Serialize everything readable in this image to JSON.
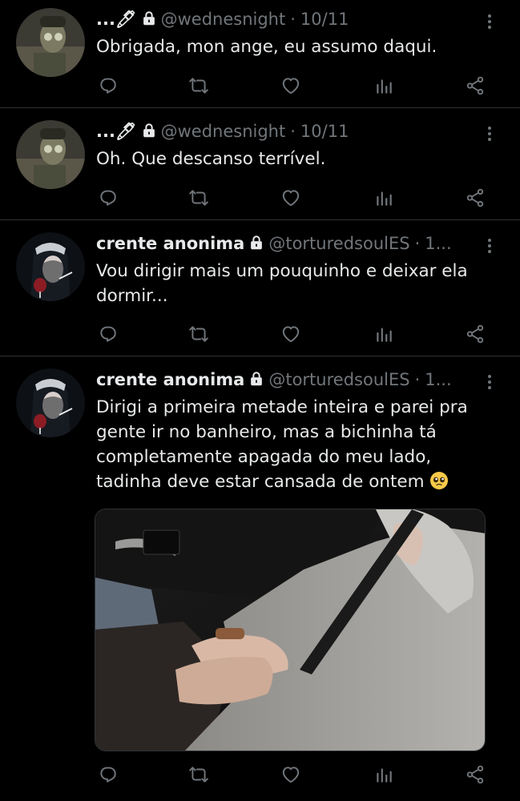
{
  "tweets": [
    {
      "name": "...🖊",
      "handle": "@wednesnight",
      "date": "10/11",
      "text": "Obrigada, mon ange, eu assumo daqui."
    },
    {
      "name": "...🖊",
      "handle": "@wednesnight",
      "date": "10/11",
      "text": "Oh. Que descanso terrível."
    },
    {
      "name": "crente anonima",
      "handle": "@torturedsoulES",
      "date": "1...",
      "text": "Vou dirigir mais um pouquinho e deixar ela dormir..."
    },
    {
      "name": "crente anonima",
      "handle": "@torturedsoulES",
      "date": "1...",
      "text": "Dirigi a primeira metade inteira e parei pra gente ir no banheiro, mas a bichinha tá completamente apagada do meu lado, tadinha deve estar cansada de ontem"
    }
  ],
  "separator": "·",
  "colors": {
    "background": "#000000",
    "text": "#e7e9ea",
    "secondary": "#71767b",
    "divider": "#2f3336"
  },
  "icons": [
    "reply-icon",
    "retweet-icon",
    "like-icon",
    "analytics-icon",
    "share-icon",
    "lock-icon",
    "more-icon",
    "pleading-face-emoji"
  ]
}
